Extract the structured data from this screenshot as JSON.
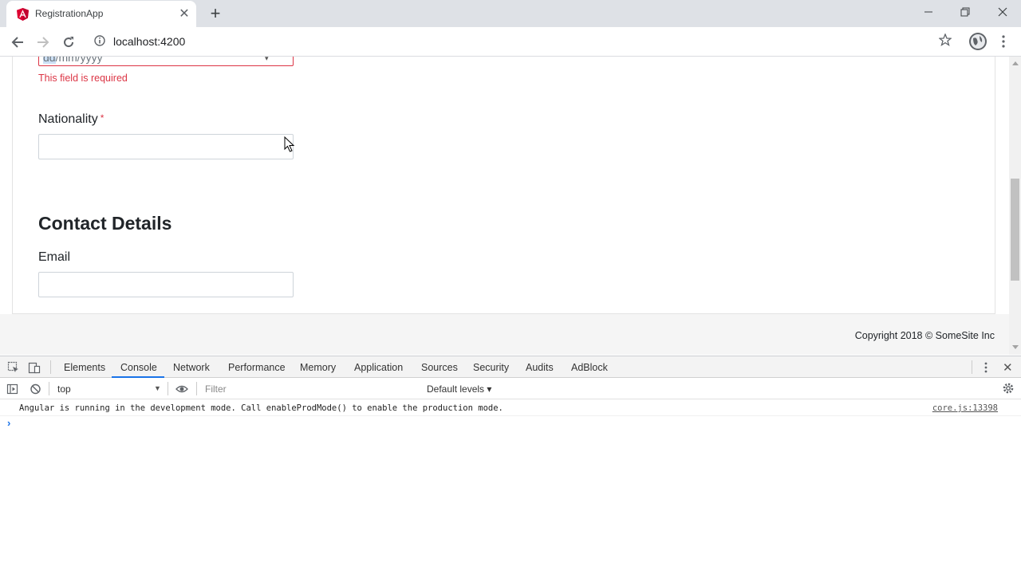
{
  "browser": {
    "tab_title": "RegistrationApp",
    "tab_close": "✕",
    "new_tab": "+",
    "url": "localhost:4200"
  },
  "form": {
    "date_placeholder_selected": "dd",
    "date_placeholder_rest": "/mm/yyyy",
    "date_error": "This field is required",
    "nationality_label": "Nationality",
    "required_marker": "*",
    "nationality_value": "",
    "section_title": "Contact Details",
    "email_label": "Email",
    "email_value": ""
  },
  "footer": {
    "copyright": "Copyright 2018 © SomeSite Inc"
  },
  "devtools": {
    "tabs": [
      "Elements",
      "Console",
      "Network",
      "Performance",
      "Memory",
      "Application",
      "Sources",
      "Security",
      "Audits",
      "AdBlock"
    ],
    "active_tab": "Console",
    "context": "top",
    "filter_placeholder": "Filter",
    "levels": "Default levels ▾",
    "log_message": "Angular is running in the development mode. Call enableProdMode() to enable the production mode.",
    "log_source": "core.js:13398",
    "prompt": "›"
  },
  "colors": {
    "error": "#dc3545",
    "accent": "#1a73e8",
    "angular_red": "#dd0031"
  }
}
